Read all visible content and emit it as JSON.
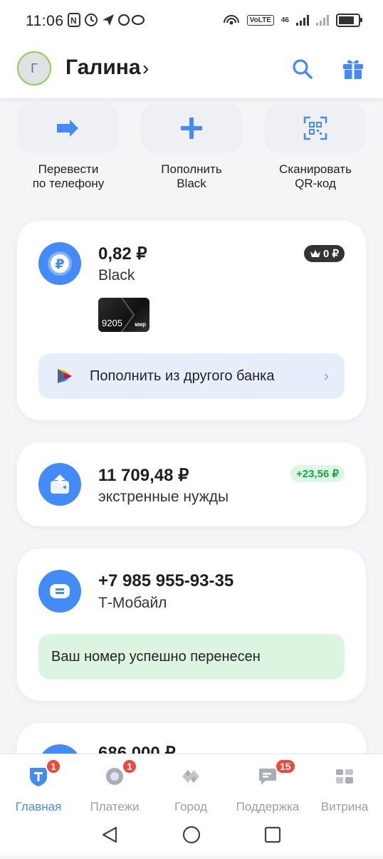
{
  "status_bar": {
    "time": "11:06",
    "net": "46",
    "volte": "VoLTE"
  },
  "header": {
    "avatar_initial": "Г",
    "user_name": "Галина",
    "chevron": "›"
  },
  "quick_actions": [
    {
      "icon": "arrow-right-icon",
      "line1": "Перевести",
      "line2": "по телефону"
    },
    {
      "icon": "plus-icon",
      "line1": "Пополнить",
      "line2": "Black"
    },
    {
      "icon": "qr-code-icon",
      "line1": "Сканировать",
      "line2": "QR-код"
    }
  ],
  "account_black": {
    "amount": "0,82 ₽",
    "name": "Black",
    "bonus_badge": "0 ₽",
    "card_last_digits": "9205",
    "card_system": "мир",
    "topup_label": "Пополнить из другого банка"
  },
  "account_savings": {
    "amount": "11 709,48 ₽",
    "name": "экстренные нужды",
    "income_badge": "+23,56 ₽"
  },
  "mobile": {
    "phone": "+7 985 955-93-35",
    "operator": "Т-Мобайл",
    "notice": "Ваш номер успешно перенесен"
  },
  "partial_card": {
    "amount": "686 000 ₽"
  },
  "bottom_nav": [
    {
      "label": "Главная",
      "badge": "1",
      "icon": "home-t-icon",
      "active": true
    },
    {
      "label": "Платежи",
      "badge": "1",
      "icon": "payments-icon"
    },
    {
      "label": "Город",
      "badge": "",
      "icon": "city-icon"
    },
    {
      "label": "Поддержка",
      "badge": "15",
      "icon": "chat-icon"
    },
    {
      "label": "Витрина",
      "badge": "",
      "icon": "grid-icon"
    }
  ],
  "colors": {
    "accent": "#428bf9",
    "green": "#1aa34a",
    "badge_red": "#f0473a"
  }
}
